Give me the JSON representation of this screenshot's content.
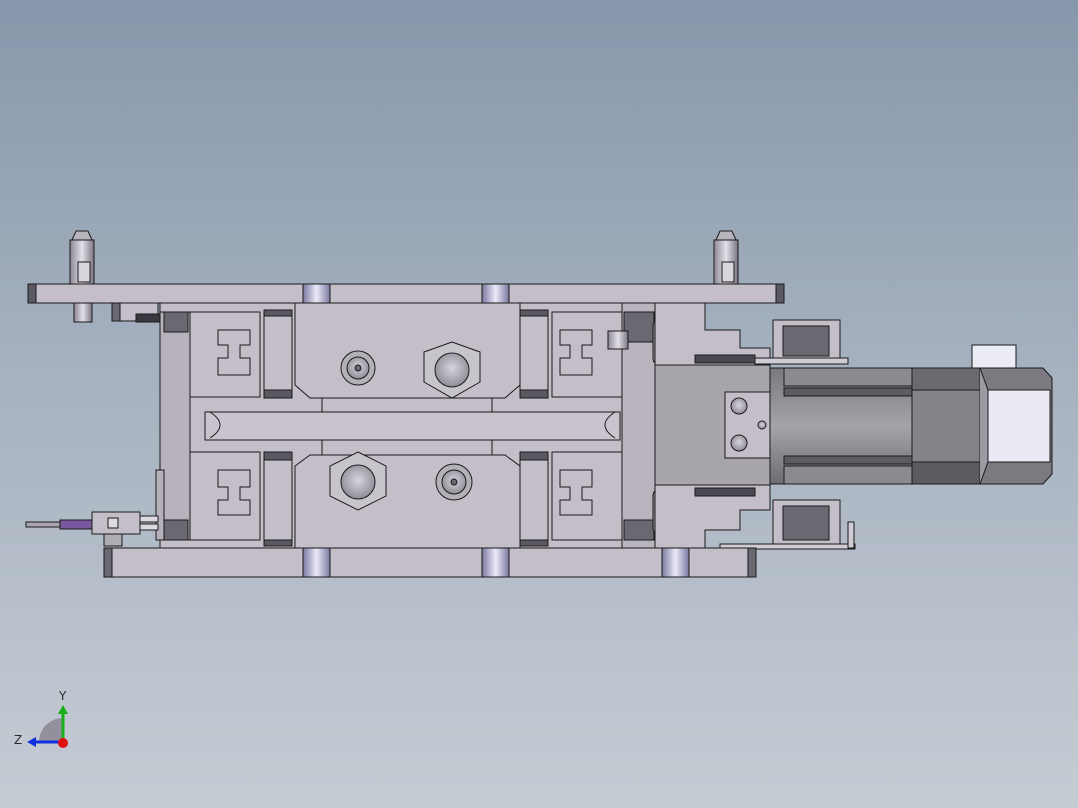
{
  "viewport": {
    "background_top": "#8797ab",
    "background_bottom": "#c6ccd4"
  },
  "triad": {
    "y_label": "Y",
    "z_label": "Z",
    "x_axis_color": "#e01010",
    "y_axis_color": "#18b018",
    "z_axis_color": "#1030e0"
  },
  "model": {
    "part_color": "#c4bec8",
    "edge_color": "#1a1a1a"
  }
}
